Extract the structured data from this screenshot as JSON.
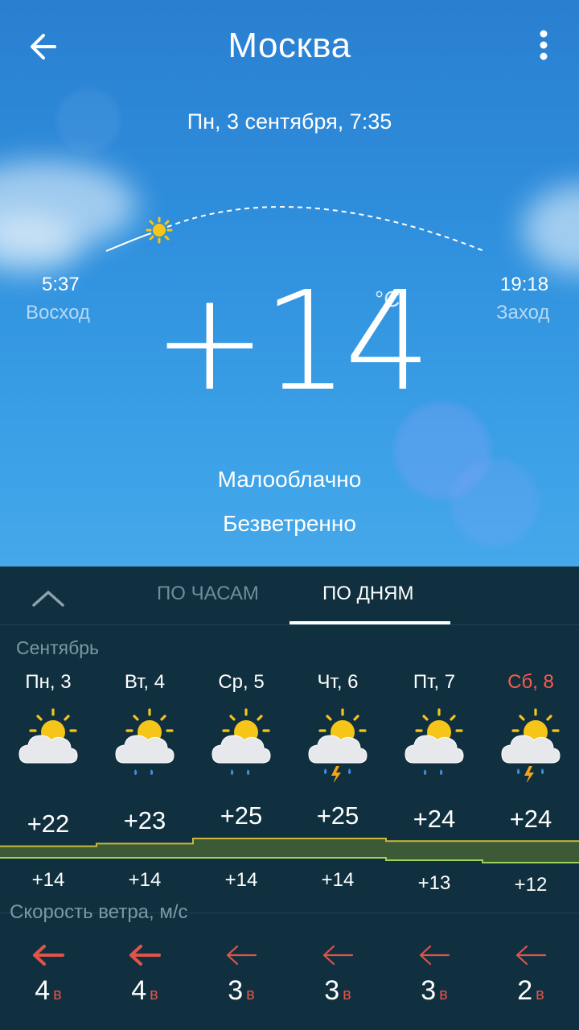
{
  "header": {
    "city": "Москва",
    "date": "Пн, 3 сентября, 7:35"
  },
  "sun": {
    "sunrise_time": "5:37",
    "sunrise_label": "Восход",
    "sunset_time": "19:18",
    "sunset_label": "Заход"
  },
  "current": {
    "temperature": "+14",
    "unit": "°C",
    "condition": "Малооблачно",
    "wind": "Безветренно"
  },
  "tabs": {
    "hours": "ПО ЧАСАМ",
    "days": "ПО ДНЯМ"
  },
  "forecast": {
    "month": "Сентябрь",
    "days": [
      {
        "label": "Пн, 3",
        "max": "+22",
        "min": "+14",
        "weather": "partly-cloudy",
        "weekend": false
      },
      {
        "label": "Вт, 4",
        "max": "+23",
        "min": "+14",
        "weather": "partly-cloudy-rain",
        "weekend": false
      },
      {
        "label": "Ср, 5",
        "max": "+25",
        "min": "+14",
        "weather": "partly-cloudy-rain",
        "weekend": false
      },
      {
        "label": "Чт, 6",
        "max": "+25",
        "min": "+14",
        "weather": "partly-cloudy-thunderstorm",
        "weekend": false
      },
      {
        "label": "Пт, 7",
        "max": "+24",
        "min": "+13",
        "weather": "partly-cloudy-rain",
        "weekend": false
      },
      {
        "label": "Сб, 8",
        "max": "+24",
        "min": "+12",
        "weather": "partly-cloudy-thunderstorm",
        "weekend": true
      }
    ]
  },
  "wind": {
    "title": "Скорость ветра, м/с",
    "days": [
      {
        "speed": "4",
        "dir": "в"
      },
      {
        "speed": "4",
        "dir": "в"
      },
      {
        "speed": "3",
        "dir": "в"
      },
      {
        "speed": "3",
        "dir": "в"
      },
      {
        "speed": "3",
        "dir": "в"
      },
      {
        "speed": "2",
        "dir": "в"
      }
    ]
  },
  "colors": {
    "sky": "#2f8fdd",
    "panel": "#103040",
    "weekend": "#ff5a4a",
    "wind_arrow": "#e0544a",
    "sun": "#f5c518",
    "graph_fill": "#3c5a36",
    "graph_line": "#c9b93a"
  }
}
